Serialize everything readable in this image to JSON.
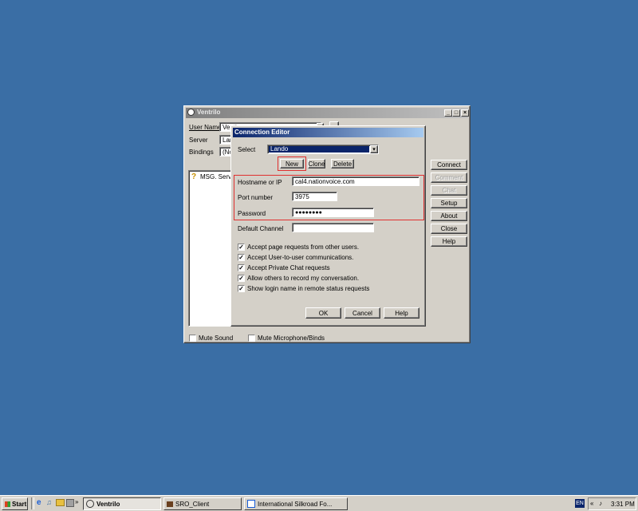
{
  "ventrilo": {
    "title": "Ventrilo",
    "username_label": "User Name",
    "username_value": "Venti",
    "server_label": "Server",
    "server_value": "Lan",
    "bindings_label": "Bindings",
    "bindings_value": "(Nor",
    "list_item": "MSG. Serve",
    "buttons": {
      "connect": "Connect",
      "comment": "Comment",
      "chat": "Chat",
      "setup": "Setup",
      "about": "About",
      "close": "Close",
      "help": "Help"
    },
    "mute_sound": "Mute Sound",
    "mute_mic": "Mute Microphone/Binds"
  },
  "editor": {
    "title": "Connection Editor",
    "select_label": "Select",
    "select_value": "Lando",
    "new_label": "New",
    "clone_label": "Clone",
    "delete_label": "Delete",
    "hostname_label": "Hostname or IP",
    "hostname_value": "cal4.nationvoice.com",
    "port_label": "Port number",
    "port_value": "3975",
    "password_label": "Password",
    "password_value": "●●●●●●●●",
    "default_channel_label": "Default Channel",
    "default_channel_value": "",
    "checkboxes": [
      "Accept page requests from other users.",
      "Accept User-to-user communications.",
      "Accept Private Chat requests",
      "Allow others to record my conversation.",
      "Show login name in remote status requests"
    ],
    "ok_label": "OK",
    "cancel_label": "Cancel",
    "help_label": "Help"
  },
  "taskbar": {
    "start_label": "Start",
    "tasks": [
      "Ventrilo",
      "SRO_Client",
      "International Silkroad Fo..."
    ],
    "lang": "EN",
    "clock": "3:31 PM"
  }
}
